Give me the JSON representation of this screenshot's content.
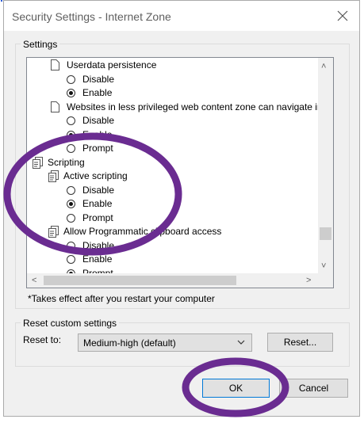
{
  "window": {
    "title": "Security Settings - Internet Zone"
  },
  "settings_group": {
    "label": "Settings"
  },
  "list": {
    "rows": [
      {
        "kind": "item",
        "label": "Userdata persistence"
      },
      {
        "kind": "option",
        "label": "Disable",
        "checked": false
      },
      {
        "kind": "option",
        "label": "Enable",
        "checked": true
      },
      {
        "kind": "item",
        "label": "Websites in less privileged web content zone can navigate in"
      },
      {
        "kind": "option",
        "label": "Disable",
        "checked": false
      },
      {
        "kind": "option",
        "label": "Enable",
        "checked": true
      },
      {
        "kind": "option",
        "label": "Prompt",
        "checked": false
      },
      {
        "kind": "category",
        "label": "Scripting"
      },
      {
        "kind": "subcategory",
        "label": "Active scripting"
      },
      {
        "kind": "option",
        "label": "Disable",
        "checked": false
      },
      {
        "kind": "option",
        "label": "Enable",
        "checked": true
      },
      {
        "kind": "option",
        "label": "Prompt",
        "checked": false
      },
      {
        "kind": "subcategory",
        "label": "Allow Programmatic clipboard access"
      },
      {
        "kind": "option",
        "label": "Disable",
        "checked": false
      },
      {
        "kind": "option",
        "label": "Enable",
        "checked": false
      },
      {
        "kind": "option",
        "label": "Prompt",
        "checked": true
      }
    ]
  },
  "note": "*Takes effect after you restart your computer",
  "reset_group": {
    "legend": "Reset custom settings",
    "reset_to_label": "Reset to:",
    "selected": "Medium-high (default)",
    "reset_button": "Reset..."
  },
  "buttons": {
    "ok": "OK",
    "cancel": "Cancel"
  },
  "colors": {
    "annotation": "#6a2c91",
    "accent": "#0078d7"
  }
}
